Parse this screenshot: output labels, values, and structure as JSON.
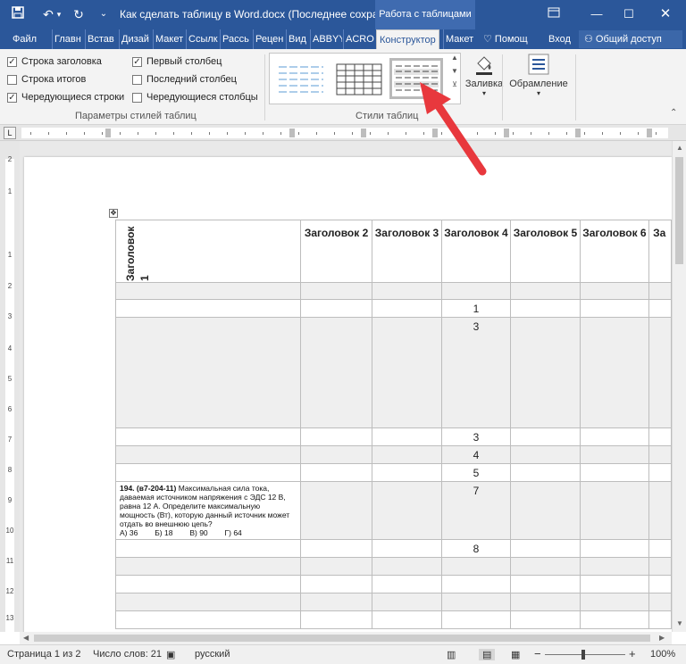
{
  "titlebar": {
    "save_icon": "save-icon",
    "undo_icon": "undo-icon",
    "redo_icon": "redo-icon",
    "doc_title": "Как сделать таблицу в Word.docx (Последнее сохране...",
    "context_label": "Работа с таблицами",
    "ribbon_options_icon": "ribbon-display-options-icon",
    "minimize_icon": "minimize-icon",
    "maximize_icon": "maximize-icon",
    "close_icon": "close-icon"
  },
  "tabs": {
    "file": "Файл",
    "home": "Главн",
    "insert": "Встав",
    "design": "Дизай",
    "layout1": "Макет",
    "references": "Ссылк",
    "mailings": "Рассь",
    "review": "Рецен",
    "view": "Вид",
    "abbyy": "ABBYY",
    "acro": "ACRO",
    "constructor": "Конструктор",
    "layout2": "Макет",
    "help": "Помощ",
    "signin": "Вход",
    "share": "Общий доступ"
  },
  "ribbon": {
    "options": {
      "header_row": "Строка заголовка",
      "first_column": "Первый столбец",
      "total_row": "Строка итогов",
      "last_column": "Последний столбец",
      "banded_rows": "Чередующиеся строки",
      "banded_columns": "Чередующиеся столбцы",
      "group_label": "Параметры стилей таблиц"
    },
    "styles_group_label": "Стили таблиц",
    "shading_label": "Заливка",
    "borders_label": "Обрамление"
  },
  "document": {
    "table": {
      "header_first": "Заголовок 1",
      "headers": [
        "Заголовок 2",
        "Заголовок 3",
        "Заголовок 4",
        "Заголовок 5",
        "Заголовок 6",
        "За"
      ],
      "col4_values": [
        "1",
        "3",
        "3",
        "4",
        "5",
        "7",
        "8"
      ],
      "question": {
        "number": "194.",
        "code": "(в7-204-11)",
        "text": "Максимальная сила тока, даваемая источником напряжения с ЭДС 12 В, равна 12 А. Определите максимальную мощность (Вт), которую данный источник может отдать во внешнюю цепь?",
        "answers": "А) 36        Б) 18        В) 90        Г) 64"
      }
    }
  },
  "ruler": {
    "vertical_numbers": [
      "2",
      "1",
      "1",
      "2",
      "3",
      "4",
      "5",
      "6",
      "7",
      "8",
      "9",
      "10",
      "11",
      "12",
      "13"
    ]
  },
  "statusbar": {
    "page": "Страница 1 из 2",
    "words": "Число слов: 21",
    "language": "русский",
    "zoom": "100%",
    "zoom_out": "−",
    "zoom_in": "+"
  },
  "colors": {
    "word_blue": "#2b579a",
    "arrow_red": "#e8383d"
  }
}
